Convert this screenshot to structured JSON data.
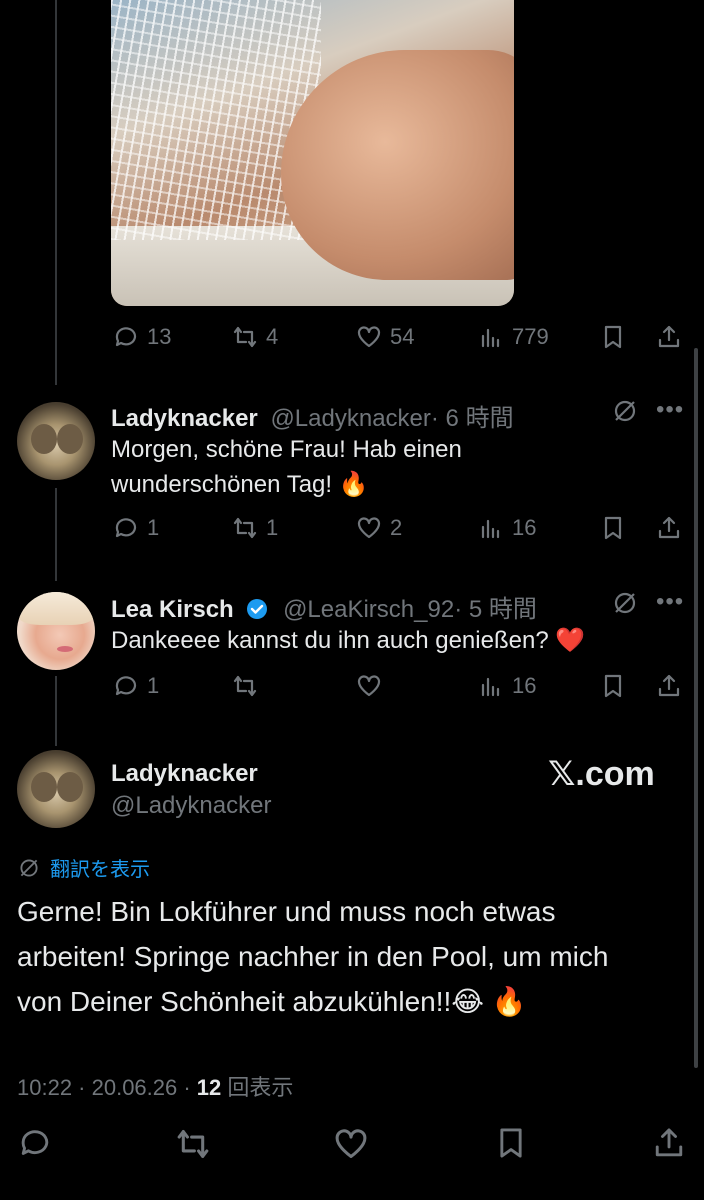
{
  "post1": {
    "actions": {
      "replies": "13",
      "reposts": "4",
      "likes": "54",
      "views": "779"
    }
  },
  "reply1": {
    "name": "Ladyknacker",
    "handle": "@Ladyknacker",
    "time": "· 6 時間",
    "text_line1": "Morgen, schöne Frau! Hab einen",
    "text_line2": "wunderschönen Tag! 🔥",
    "actions": {
      "replies": "1",
      "reposts": "1",
      "likes": "2",
      "views": "16"
    }
  },
  "reply2": {
    "name": "Lea Kirsch",
    "handle": "@LeaKirsch_92",
    "time": "· 5 時間",
    "text": "Dankeeee kannst du ihn auch genießen? ❤️",
    "actions": {
      "replies": "1",
      "reposts": "",
      "likes": "",
      "views": "16"
    }
  },
  "main": {
    "name": "Ladyknacker",
    "handle": "@Ladyknacker",
    "watermark": "𝕏.com",
    "translate": "翻訳を表示",
    "text_line1": "Gerne! Bin Lokführer und muss noch etwas",
    "text_line2": "arbeiten! Springe nachher in den Pool, um mich",
    "text_line3": "von Deiner Schönheit abzukühlen!!😂 🔥",
    "timestamp": "10:22 · 20.06.26 · ",
    "views_count": "12",
    "views_label": " 回表示"
  },
  "colors": {
    "background": "#000000",
    "text": "#e7e9ea",
    "muted": "#71767b",
    "accent": "#1d9bf0",
    "verified": "#1d9bf0"
  }
}
